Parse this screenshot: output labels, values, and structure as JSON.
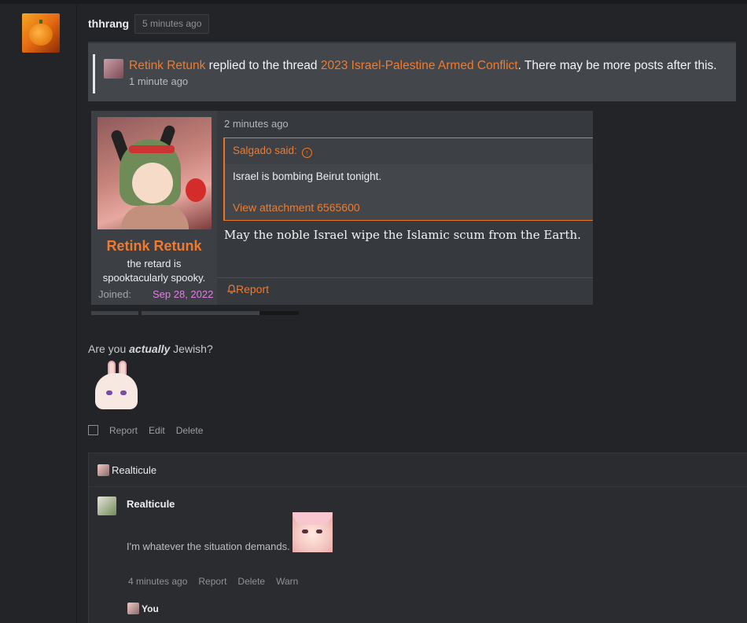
{
  "post": {
    "author": "thhrang",
    "time": "5 minutes ago"
  },
  "notice": {
    "user": "Retink Retunk",
    "middle": " replied to the thread ",
    "thread": "2023 Israel-Palestine Armed Conflict",
    "tail": ". There may be more posts after this.",
    "time": "1 minute ago"
  },
  "card": {
    "name": "Retink Retunk",
    "user_title": "the retard is spooktacularly spooky.",
    "joined_label": "Joined:",
    "joined_value": "Sep 28, 2022",
    "time": "2 minutes ago",
    "quote_author": "Salgado said:",
    "quote_text": "Israel is bombing Beirut tonight.",
    "attachment_link": "View attachment 6565600",
    "body": "May the noble Israel wipe the Islamic scum from the Earth.",
    "report": "Report"
  },
  "reply": {
    "prefix": "Are you ",
    "emphasis": "actually",
    "suffix": " Jewish?"
  },
  "actions": {
    "report": "Report",
    "edit": "Edit",
    "delete": "Delete"
  },
  "comments": {
    "header_user": "Realticule",
    "comment_user": "Realticule",
    "comment_text": "I'm whatever the situation demands.",
    "meta": {
      "time": "4 minutes ago",
      "report": "Report",
      "delete": "Delete",
      "warn": "Warn"
    },
    "you_label": "You"
  },
  "colors": {
    "accent": "#f07a2d",
    "joined_date": "#e57de6",
    "background": "#222427"
  }
}
